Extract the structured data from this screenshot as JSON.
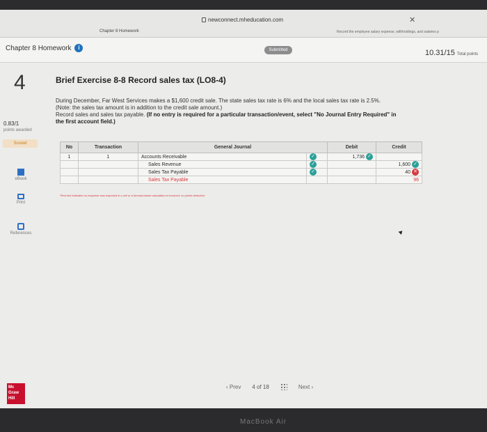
{
  "browser": {
    "url": "newconnect.mheducation.com",
    "tab_left": "Chapter 8 Homework",
    "tab_right": "Record the employee salary expense, withholdings, and salaries p"
  },
  "header": {
    "chapter_title": "Chapter 8 Homework",
    "status": "Submitted",
    "score": "10.31/15",
    "score_label": "Total points"
  },
  "question": {
    "number": "4",
    "title": "Brief Exercise 8-8 Record sales tax (LO8-4)",
    "line1": "During December, Far West Services makes a $1,600 credit sale. The state sales tax rate is 6% and the local sales tax rate is 2.5%.",
    "line2": "(Note: the sales tax amount is in addition to the credit sale amount.)",
    "line3": "Record sales and sales tax payable.",
    "line3_bold": "(If no entry is required for a particular transaction/event, select \"No Journal Entry Required\" in",
    "line4_bold": "the first account field.)",
    "points": "0.83/1",
    "points_label": "points awarded",
    "scored_badge": "Scored"
  },
  "sidebar": {
    "ebook": "eBook",
    "print": "Print",
    "references": "References"
  },
  "journal": {
    "headers": [
      "No",
      "Transaction",
      "General Journal",
      "Debit",
      "Credit"
    ],
    "rows": [
      {
        "no": "1",
        "transaction": "1",
        "account": "Accounts Receivable",
        "debit": "1,736",
        "credit": ""
      },
      {
        "no": "",
        "transaction": "",
        "account": "Sales Revenue",
        "debit": "",
        "credit": "1,600"
      },
      {
        "no": "",
        "transaction": "",
        "account": "Sales Tax Payable",
        "debit": "",
        "credit": "40"
      },
      {
        "no": "",
        "transaction": "",
        "account": "Sales Tax Payable",
        "debit": "",
        "credit": "96"
      }
    ],
    "note": "*Red text indicates no response was expected in a cell or a formula-based calculation is incorrect; no points deducted."
  },
  "footer": {
    "logo": "Mc Graw Hill",
    "prev": "Prev",
    "page": "4 of 18",
    "next": "Next"
  },
  "device": {
    "label": "MacBook Air"
  }
}
